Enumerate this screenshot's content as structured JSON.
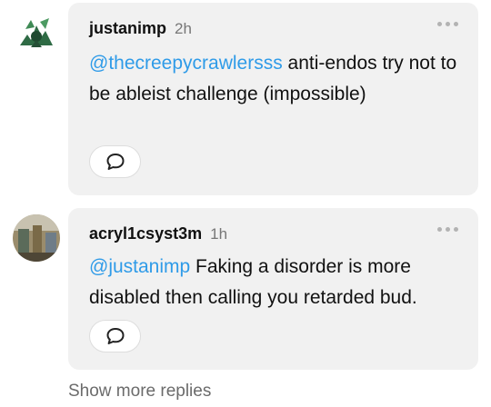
{
  "replies": [
    {
      "username": "justanimp",
      "time": "2h",
      "mention": "@thecreepycrawlersss",
      "text": " anti-endos try not to be ableist challenge (impossible)",
      "avatar_color": "#2f6b45"
    },
    {
      "username": "acryl1csyst3m",
      "time": "1h",
      "mention": "@justanimp",
      "text": " Faking a disorder is more disabled then calling you retarded bud.",
      "avatar_color": "#8a7a5a"
    }
  ],
  "show_more_label": "Show more replies",
  "icons": {
    "more": "more-options-icon",
    "reply": "speech-bubble-icon"
  },
  "colors": {
    "bubble": "#f1f1f1",
    "mention": "#2f9be8",
    "muted": "#6b6b6b"
  }
}
